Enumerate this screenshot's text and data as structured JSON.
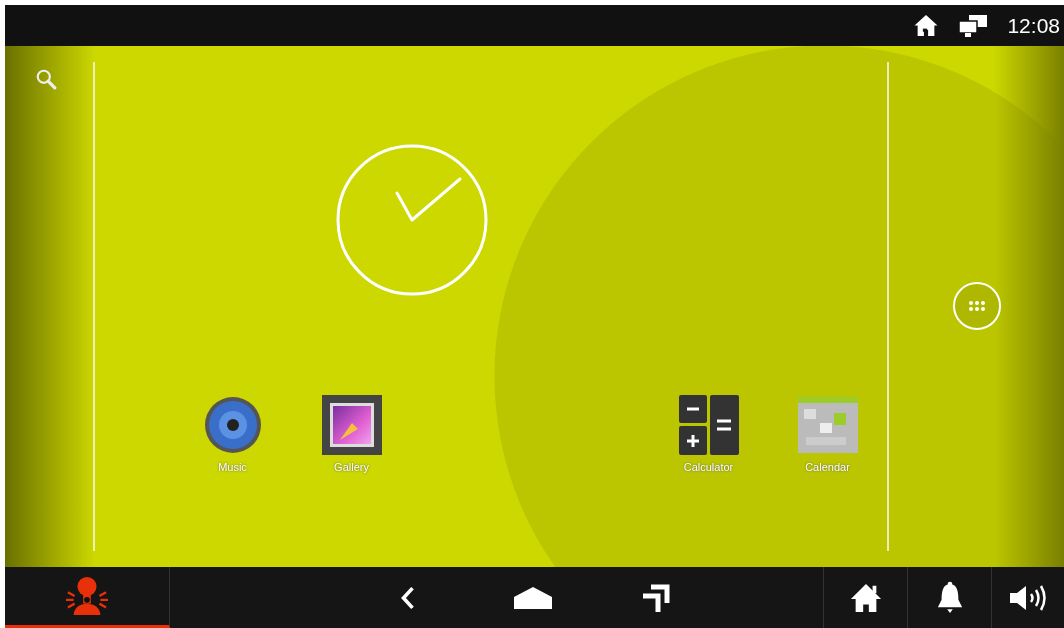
{
  "status_bar": {
    "time": "12:08"
  },
  "home_screen": {
    "apps": [
      {
        "label": "Music",
        "kind": "music"
      },
      {
        "label": "Gallery",
        "kind": "gallery"
      },
      {
        "label": "Calculator",
        "kind": "calculator"
      },
      {
        "label": "Calendar",
        "kind": "calendar"
      }
    ]
  },
  "nav_bar": {
    "alert_tab": {
      "selected": true
    }
  }
}
